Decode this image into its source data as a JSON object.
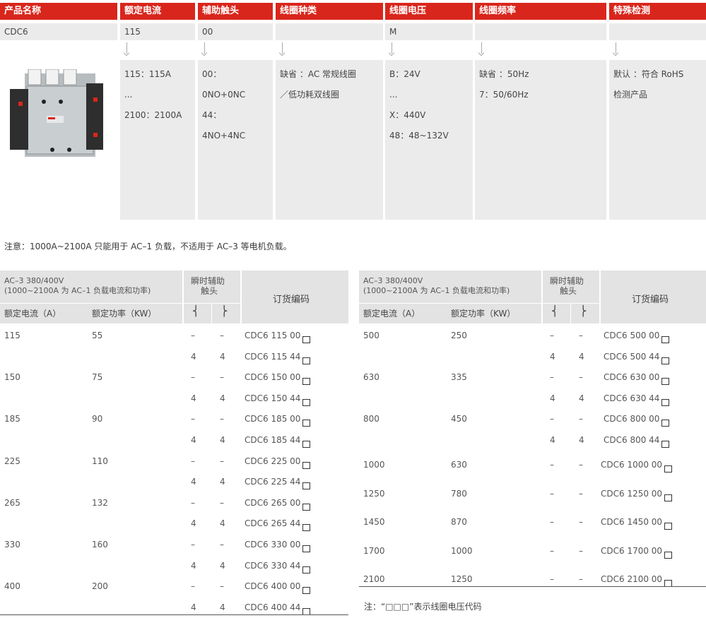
{
  "spec": {
    "headers": [
      "产品名称",
      "额定电流",
      "辅助触头",
      "线圈种类",
      "线圈电压",
      "线圈频率",
      "特殊检测"
    ],
    "sample": [
      "CDC6",
      "115",
      "00",
      "",
      "M",
      "",
      ""
    ],
    "col_current": [
      "115：115A",
      "...",
      "2100：2100A"
    ],
    "col_aux": [
      "00：",
      "0NO+0NC",
      "44：",
      "4NO+4NC"
    ],
    "col_coil_type": [
      "缺省 ：AC 常规线圈",
      "／低功耗双线圈"
    ],
    "col_voltage": [
      "B：24V",
      "...",
      "X：440V",
      "48：48~132V"
    ],
    "col_freq": [
      "缺省 ：50Hz",
      "7：50/60Hz"
    ],
    "col_test": [
      "默认 ：符合 RoHS",
      "检测产品"
    ]
  },
  "note": "注意：1000A~2100A 只能用于 AC–1 负载，不适用于 AC–3 等电机负载。",
  "order_header": {
    "ac3_line1": "AC–3 380/400V",
    "ac3_line2": "(1000~2100A 为 AC–1 负载电流和功率)",
    "aux_line1": "瞬时辅助",
    "aux_line2": "触头",
    "code": "订货编码",
    "current": "额定电流（A）",
    "power": "额定功率（KW）",
    "no_symbol": "⎨",
    "nc_symbol": "⎬"
  },
  "left_rows": [
    {
      "current": "115",
      "power": "55",
      "no": "–",
      "nc": "–",
      "code": "CDC6  115  00"
    },
    {
      "current": "",
      "power": "",
      "no": "4",
      "nc": "4",
      "code": "CDC6  115  44"
    },
    {
      "current": "150",
      "power": "75",
      "no": "–",
      "nc": "–",
      "code": "CDC6  150  00"
    },
    {
      "current": "",
      "power": "",
      "no": "4",
      "nc": "4",
      "code": "CDC6  150  44"
    },
    {
      "current": "185",
      "power": "90",
      "no": "–",
      "nc": "–",
      "code": "CDC6  185  00"
    },
    {
      "current": "",
      "power": "",
      "no": "4",
      "nc": "4",
      "code": "CDC6  185  44"
    },
    {
      "current": "225",
      "power": "110",
      "no": "–",
      "nc": "–",
      "code": "CDC6  225  00"
    },
    {
      "current": "",
      "power": "",
      "no": "4",
      "nc": "4",
      "code": "CDC6  225  44"
    },
    {
      "current": "265",
      "power": "132",
      "no": "–",
      "nc": "–",
      "code": "CDC6  265  00"
    },
    {
      "current": "",
      "power": "",
      "no": "4",
      "nc": "4",
      "code": "CDC6  265  44"
    },
    {
      "current": "330",
      "power": "160",
      "no": "–",
      "nc": "–",
      "code": "CDC6  330  00"
    },
    {
      "current": "",
      "power": "",
      "no": "4",
      "nc": "4",
      "code": "CDC6  330  44"
    },
    {
      "current": "400",
      "power": "200",
      "no": "–",
      "nc": "–",
      "code": "CDC6  400  00"
    },
    {
      "current": "",
      "power": "",
      "no": "4",
      "nc": "4",
      "code": "CDC6  400  44"
    }
  ],
  "right_rows_a": [
    {
      "current": "500",
      "power": "250",
      "no": "–",
      "nc": "–",
      "code": "CDC6  500  00"
    },
    {
      "current": "",
      "power": "",
      "no": "4",
      "nc": "4",
      "code": "CDC6  500  44"
    },
    {
      "current": "630",
      "power": "335",
      "no": "–",
      "nc": "–",
      "code": "CDC6  630  00"
    },
    {
      "current": "",
      "power": "",
      "no": "4",
      "nc": "4",
      "code": "CDC6  630  44"
    },
    {
      "current": "800",
      "power": "450",
      "no": "–",
      "nc": "–",
      "code": "CDC6  800  00"
    },
    {
      "current": "",
      "power": "",
      "no": "4",
      "nc": "4",
      "code": "CDC6  800  44"
    }
  ],
  "right_rows_b": [
    {
      "current": "1000",
      "power": "630",
      "no": "–",
      "nc": "–",
      "code": "CDC6  1000  00"
    },
    {
      "current": "1250",
      "power": "780",
      "no": "–",
      "nc": "–",
      "code": "CDC6  1250  00"
    },
    {
      "current": "1450",
      "power": "870",
      "no": "–",
      "nc": "–",
      "code": "CDC6  1450  00"
    },
    {
      "current": "1700",
      "power": "1000",
      "no": "–",
      "nc": "–",
      "code": "CDC6  1700  00"
    },
    {
      "current": "2100",
      "power": "1250",
      "no": "–",
      "nc": "–",
      "code": "CDC6  2100  00"
    }
  ],
  "footnote": "注：“□□□”表示线圈电压代码",
  "colors": {
    "header_red": "#d9261c",
    "grey": "#ebebeb",
    "table_head": "#e3e3e3"
  }
}
